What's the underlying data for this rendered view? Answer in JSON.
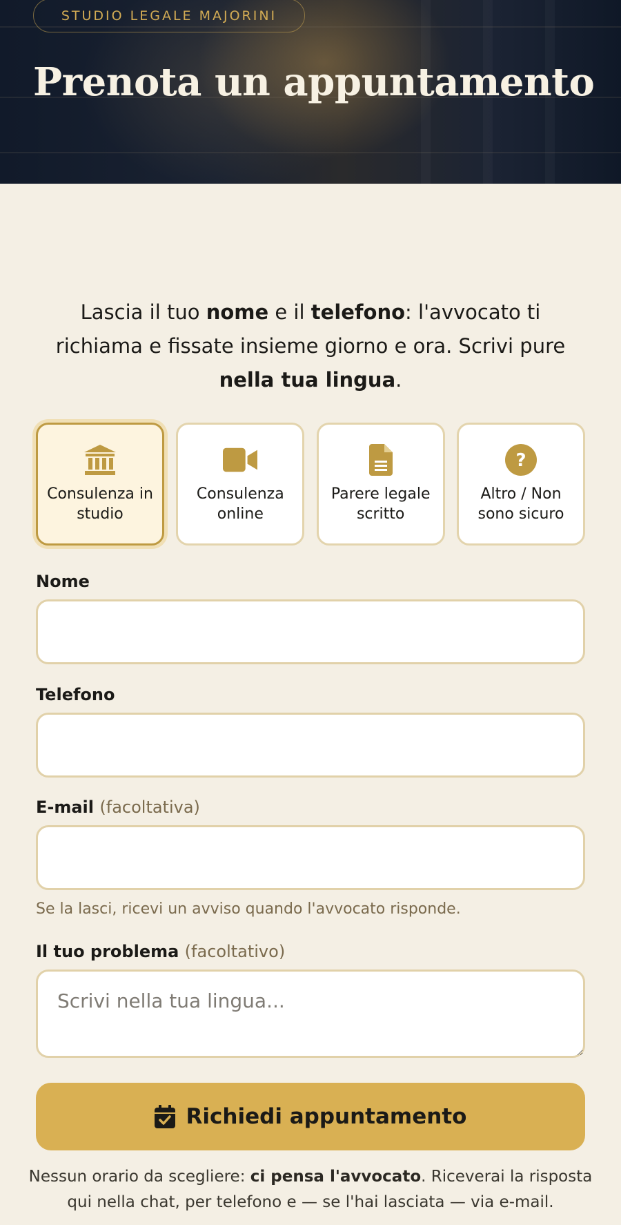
{
  "hero": {
    "badge": "STUDIO LEGALE MAJORINI",
    "title": "Prenota un appuntamento"
  },
  "intro": {
    "p1": "Lascia il tuo ",
    "b1": "nome",
    "p2": " e il ",
    "b2": "telefono",
    "p3": ": l'avvocato ti richiama e fissate insieme giorno e ora. Scrivi pure ",
    "b3": "nella tua lingua",
    "p4": "."
  },
  "types": [
    {
      "label": "Consulenza in studio",
      "icon": "bank-icon",
      "selected": true
    },
    {
      "label": "Consulenza online",
      "icon": "video-camera-icon",
      "selected": false
    },
    {
      "label": "Parere legale scritto",
      "icon": "document-icon",
      "selected": false
    },
    {
      "label": "Altro / Non sono sicuro",
      "icon": "question-circle-icon",
      "selected": false
    }
  ],
  "form": {
    "name_label": "Nome",
    "phone_label": "Telefono",
    "email_label": "E-mail",
    "email_optional": "(facoltativa)",
    "email_hint": "Se la lasci, ricevi un avviso quando l'avvocato risponde.",
    "problem_label": "Il tuo problema",
    "problem_optional": "(facoltativo)",
    "problem_placeholder": "Scrivi nella tua lingua...",
    "name_value": "",
    "phone_value": "",
    "email_value": ""
  },
  "submit": {
    "label": "Richiedi appuntamento",
    "icon": "calendar-check-icon"
  },
  "footer": {
    "p1": "Nessun orario da scegliere: ",
    "b1": "ci pensa l'avvocato",
    "p2": ". Riceverai la risposta qui nella chat, per telefono e — se l'hai lasciata — via e-mail."
  },
  "colors": {
    "accent": "#d9b053",
    "accent_dark": "#be9a42",
    "background": "#f4efe4",
    "hero_dark": "#131c2b"
  }
}
